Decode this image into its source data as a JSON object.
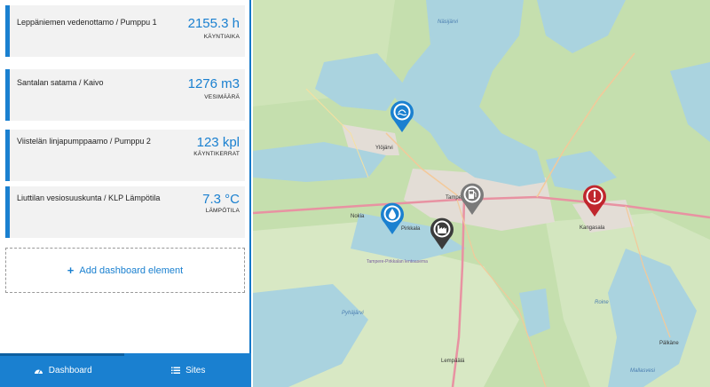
{
  "sidebar": {
    "cards": [
      {
        "name": "Leppäniemen vedenottamo / Pumppu 1",
        "value": "2155.3 h",
        "unit_label": "KÄYNTIAIKA"
      },
      {
        "name": "Santalan satama / Kaivo",
        "value": "1276 m3",
        "unit_label": "VESIMÄÄRÄ"
      },
      {
        "name": "Viistelän linjapumppaamo / Pumppu 2",
        "value": "123 kpl",
        "unit_label": "KÄYNTIKERRAT"
      },
      {
        "name": "Liuttilan vesiosuuskunta / KLP Lämpötila",
        "value": "7.3 °C",
        "unit_label": "LÄMPÖTILA"
      }
    ],
    "add_label": "Add dashboard element"
  },
  "nav": {
    "dashboard_label": "Dashboard",
    "sites_label": "Sites"
  },
  "map": {
    "labels": {
      "nasijarvi": "Näsijärvi",
      "ylojarvi": "Ylöjärvi",
      "tampere": "Tampe",
      "nokia": "Nokia",
      "pirkkala": "Pirkkala",
      "kangasala": "Kangasala",
      "lempaala": "Lempäälä",
      "pyhajarvi": "Pyhäjärvi",
      "roine": "Roine",
      "palkane": "Pälkäne",
      "mallasvesi": "Mallasvesi",
      "airport": "Tampere-Pirkkalan lentoasema"
    }
  },
  "colors": {
    "accent": "#1a80d0",
    "alert": "#c0262d",
    "marker_dark": "#3b3b3b",
    "marker_gray": "#7a7a7a"
  }
}
